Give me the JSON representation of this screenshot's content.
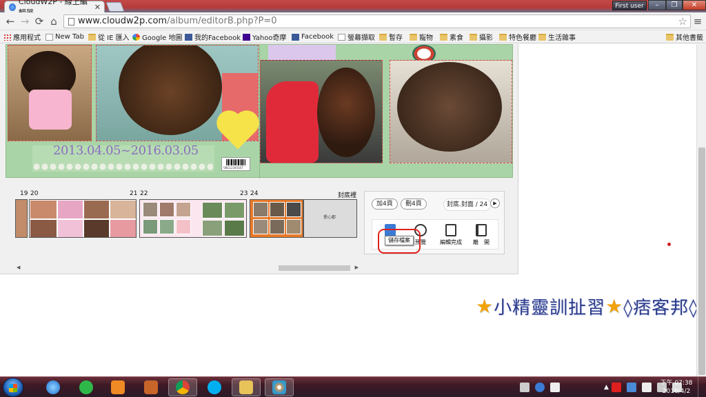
{
  "browser": {
    "tab_title": "CloudW2P - 線上編輯器",
    "tab_close": "✕",
    "user_label": "First user",
    "url_host": "www.cloudw2p.com",
    "url_path": "/album/editorB.php?P=0",
    "back_glyph": "←",
    "forward_glyph": "→",
    "reload_glyph": "⟳",
    "home_glyph": "⌂",
    "star_glyph": "☆",
    "menu_glyph": "≡",
    "min_glyph": "–",
    "max_glyph": "❐",
    "close_glyph": "✕"
  },
  "bookmarks": [
    {
      "label": "應用程式",
      "icon": "apps-icon"
    },
    {
      "label": "New Tab",
      "icon": "page-icon"
    },
    {
      "label": "從 IE 匯入",
      "icon": "folder-icon"
    },
    {
      "label": "Google 地圖",
      "icon": "google-maps-icon"
    },
    {
      "label": "我的Facebook",
      "icon": "facebook-icon"
    },
    {
      "label": "Yahoo奇摩",
      "icon": "yahoo-icon"
    },
    {
      "label": "Facebook",
      "icon": "facebook-icon"
    },
    {
      "label": "螢幕擷取",
      "icon": "page-icon"
    },
    {
      "label": "暫存",
      "icon": "folder-icon"
    },
    {
      "label": "寵物",
      "icon": "folder-icon"
    },
    {
      "label": "素食",
      "icon": "folder-icon"
    },
    {
      "label": "攝影",
      "icon": "folder-icon"
    },
    {
      "label": "特色餐廳",
      "icon": "folder-icon"
    },
    {
      "label": "生活雜事",
      "icon": "folder-icon"
    },
    {
      "label": "其他書籤",
      "icon": "folder-icon"
    }
  ],
  "editor": {
    "date_text": "2013.04.05~2016.03.05",
    "barcode_text": "VBG12345SST",
    "page_numbers": [
      "19",
      "20",
      "21",
      "22",
      "23",
      "24",
      "封底裡"
    ],
    "back_cover_text": "愛心郡",
    "add_pages_label": "加4頁",
    "delete_pages_label": "刪4頁",
    "page_indicator": "封底.封面 / 24",
    "next_glyph": "▶",
    "tools": [
      {
        "label": "儲存檔案",
        "icon": "save-icon"
      },
      {
        "label": "預覽",
        "icon": "preview-icon"
      },
      {
        "label": "編輯完成",
        "icon": "finish-edit-icon"
      },
      {
        "label": "離　開",
        "icon": "exit-icon"
      }
    ],
    "tooltip_text": "儲存檔案",
    "scroll_left": "◀",
    "scroll_right": "▶"
  },
  "watermark": {
    "star_left": "★",
    "text_1": "小精靈訓扯習",
    "star_mid": "★",
    "text_2": "◊痞客邦◊"
  },
  "taskbar": {
    "apps": [
      "internet-explorer-icon",
      "line-icon",
      "media-player-icon",
      "package-icon",
      "chrome-icon",
      "skype-icon",
      "file-explorer-icon",
      "paint-icon"
    ],
    "time": "下午 07:38",
    "date": "2016/4/2",
    "tray_arrow": "▲"
  },
  "colors": {
    "accent_green": "#a9d4a7",
    "highlight_red": "#e0201a",
    "watermark_blue": "#2a3a8a",
    "star_orange": "#f2a20a"
  }
}
